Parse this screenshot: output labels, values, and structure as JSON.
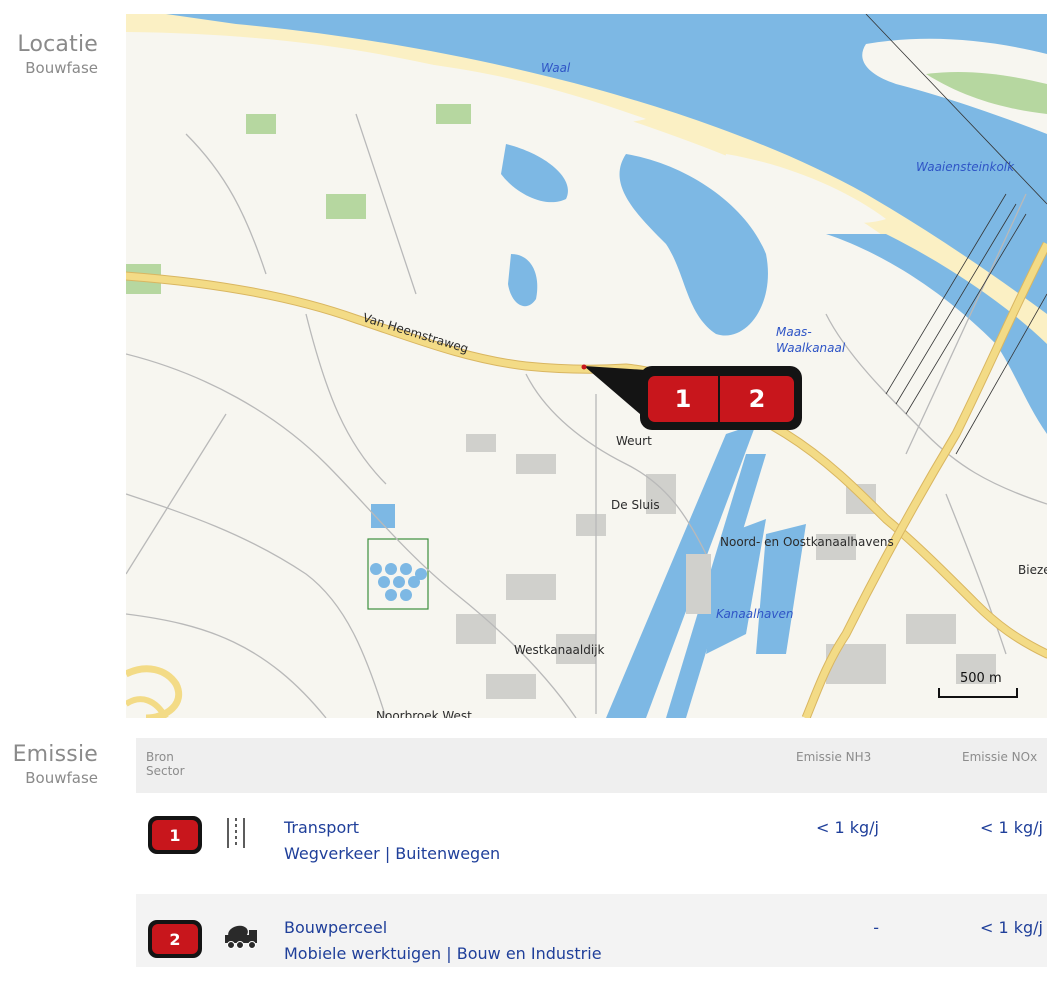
{
  "sections": {
    "location": {
      "title": "Locatie",
      "subtitle": "Bouwfase"
    },
    "emission": {
      "title": "Emissie",
      "subtitle": "Bouwfase"
    }
  },
  "map": {
    "water_labels": [
      "Waal",
      "Waaiensteinkolk",
      "Maas-Waalkanaal",
      "Kanaalhaven"
    ],
    "road_labels": [
      "Van Heemstraweg"
    ],
    "place_labels": [
      "Weurt",
      "De Sluis",
      "Noord- en Oostkanaalhavens",
      "Westkanaaldijk",
      "Bieze",
      "Noorbroek West"
    ],
    "markers": [
      "1",
      "2"
    ],
    "scale_label": "500 m",
    "colors": {
      "water": "#7db8e4",
      "road": "#f3db86",
      "land": "#f7f6f0",
      "green": "#b6d7a0",
      "marker": "#c8161c",
      "marker_frame": "#141414"
    }
  },
  "table": {
    "headers": {
      "bron": "Bron",
      "sector": "Sector",
      "nh3": "Emissie NH3",
      "nox": "Emissie NOx"
    },
    "rows": [
      {
        "badge": "1",
        "icon": "road-lane-icon",
        "title": "Transport",
        "subtitle": "Wegverkeer | Buitenwegen",
        "nh3": "< 1 kg/j",
        "nox": "< 1 kg/j"
      },
      {
        "badge": "2",
        "icon": "concrete-mixer-truck-icon",
        "title": "Bouwperceel",
        "subtitle": "Mobiele werktuigen | Bouw en Industrie",
        "nh3": "-",
        "nox": "< 1 kg/j"
      }
    ]
  }
}
